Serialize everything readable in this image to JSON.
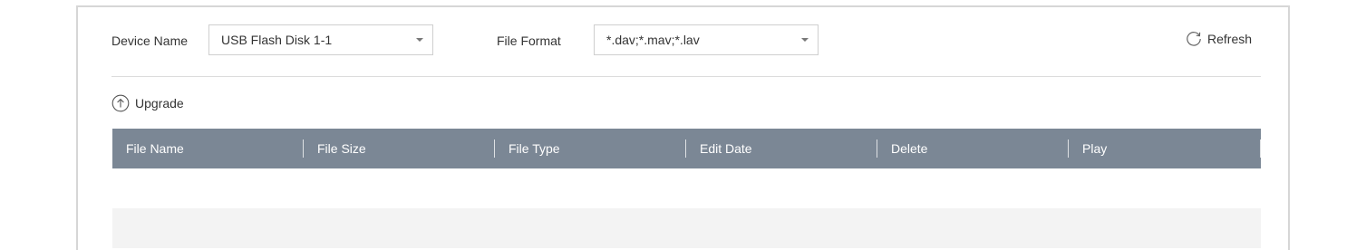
{
  "filters": {
    "device_name_label": "Device Name",
    "device_name_value": "USB Flash Disk 1-1",
    "file_format_label": "File Format",
    "file_format_value": "*.dav;*.mav;*.lav"
  },
  "toolbar": {
    "refresh_label": "Refresh",
    "upgrade_label": "Upgrade"
  },
  "table": {
    "columns": [
      "File Name",
      "File Size",
      "File Type",
      "Edit Date",
      "Delete",
      "Play"
    ],
    "rows": []
  },
  "colors": {
    "header_bg": "#7b8795",
    "row_alt_bg": "#f3f3f3",
    "border": "#d6d6d6"
  },
  "icons": {
    "refresh": "refresh-icon",
    "upgrade": "upgrade-arrow-circle-icon",
    "dropdown": "caret-down-icon"
  }
}
